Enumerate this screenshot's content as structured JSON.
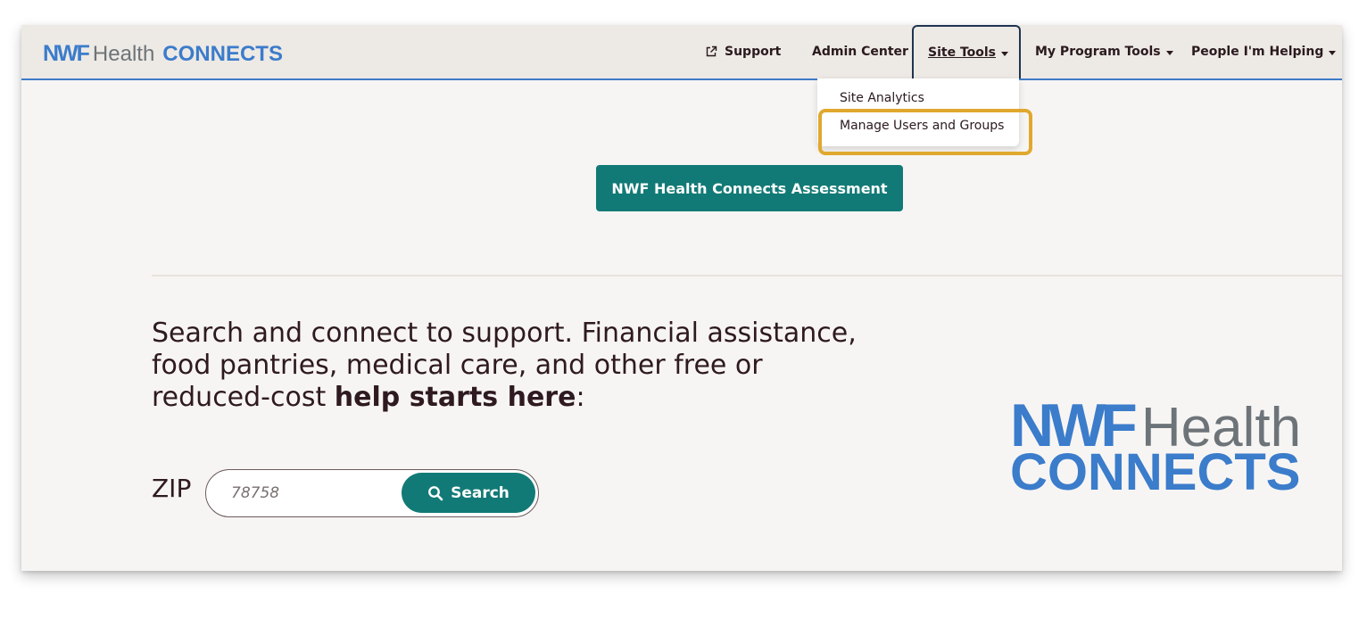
{
  "header": {
    "brand_nwf": "NWF",
    "brand_health": "Health",
    "brand_connects": "CONNECTS"
  },
  "nav": {
    "support": "Support",
    "admin_center": "Admin Center",
    "site_tools": "Site Tools",
    "my_program_tools": "My Program Tools",
    "people_helping": "People I'm Helping"
  },
  "dropdown": {
    "items": [
      "Site Analytics",
      "Manage Users and Groups"
    ]
  },
  "main": {
    "assessment_button": "NWF Health Connects Assessment",
    "headline_part1": "Search and connect to support. Financial assistance, food pantries, medical care, and other free or reduced-cost ",
    "headline_bold": "help starts here",
    "headline_end": ":",
    "zip_label": "ZIP",
    "zip_placeholder": "78758",
    "search_button": "Search"
  },
  "logo": {
    "nwf": "NWF",
    "health": "Health",
    "connects": "CONNECTS"
  },
  "colors": {
    "brand_blue": "#3b7ccb",
    "teal": "#127a76",
    "highlight": "#e0a82e",
    "navbar_bg": "#ede9e4"
  },
  "icons": [
    "external-link-icon",
    "caret-down-icon",
    "search-icon"
  ]
}
